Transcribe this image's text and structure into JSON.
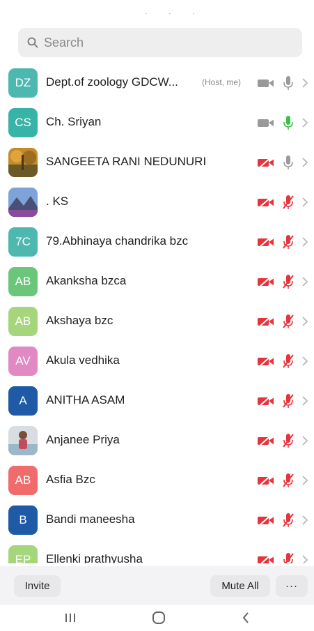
{
  "search": {
    "placeholder": "Search"
  },
  "participants": [
    {
      "initials": "DZ",
      "name": "Dept.of zoology GDCW...",
      "tag": "(Host, me)",
      "avatar_color": "#4cb8b0",
      "video": "on",
      "mic": "on-grey"
    },
    {
      "initials": "CS",
      "name": "Ch. Sriyan",
      "tag": "",
      "avatar_color": "#38b3a8",
      "video": "on",
      "mic": "on-green"
    },
    {
      "initials": "",
      "name": "SANGEETA RANI NEDUNURI",
      "tag": "",
      "avatar_photo": "photo-forest",
      "video": "off",
      "mic": "on-grey"
    },
    {
      "initials": "",
      "name": ". KS",
      "tag": "",
      "avatar_photo": "photo-mountain",
      "video": "off",
      "mic": "off"
    },
    {
      "initials": "7C",
      "name": "79.Abhinaya chandrika bzc",
      "tag": "",
      "avatar_color": "#4cb8b0",
      "video": "off",
      "mic": "off"
    },
    {
      "initials": "AB",
      "name": "Akanksha bzca",
      "tag": "",
      "avatar_color": "#6bc67a",
      "video": "off",
      "mic": "off"
    },
    {
      "initials": "AB",
      "name": "Akshaya bzc",
      "tag": "",
      "avatar_color": "#a6d67c",
      "video": "off",
      "mic": "off"
    },
    {
      "initials": "AV",
      "name": "Akula vedhika",
      "tag": "",
      "avatar_color": "#e189c3",
      "video": "off",
      "mic": "off"
    },
    {
      "initials": "A",
      "name": "ANITHA ASAM",
      "tag": "",
      "avatar_color": "#1e5aa6",
      "video": "off",
      "mic": "off"
    },
    {
      "initials": "",
      "name": "Anjanee Priya",
      "tag": "",
      "avatar_photo": "photo-person",
      "video": "off",
      "mic": "off"
    },
    {
      "initials": "AB",
      "name": "Asfia Bzc",
      "tag": "",
      "avatar_color": "#f06b6b",
      "video": "off",
      "mic": "off"
    },
    {
      "initials": "B",
      "name": "Bandi maneesha",
      "tag": "",
      "avatar_color": "#1e5aa6",
      "video": "off",
      "mic": "off"
    },
    {
      "initials": "EP",
      "name": "Ellenki prathyusha",
      "tag": "",
      "avatar_color": "#a6d67c",
      "video": "off",
      "mic": "off"
    }
  ],
  "toolbar": {
    "invite_label": "Invite",
    "mute_all_label": "Mute All",
    "more_label": "···"
  },
  "colors": {
    "video_on": "#9a9a9a",
    "muted_red": "#e8333a",
    "mic_green": "#3cbd4a",
    "chevron": "#b8b8b8"
  }
}
